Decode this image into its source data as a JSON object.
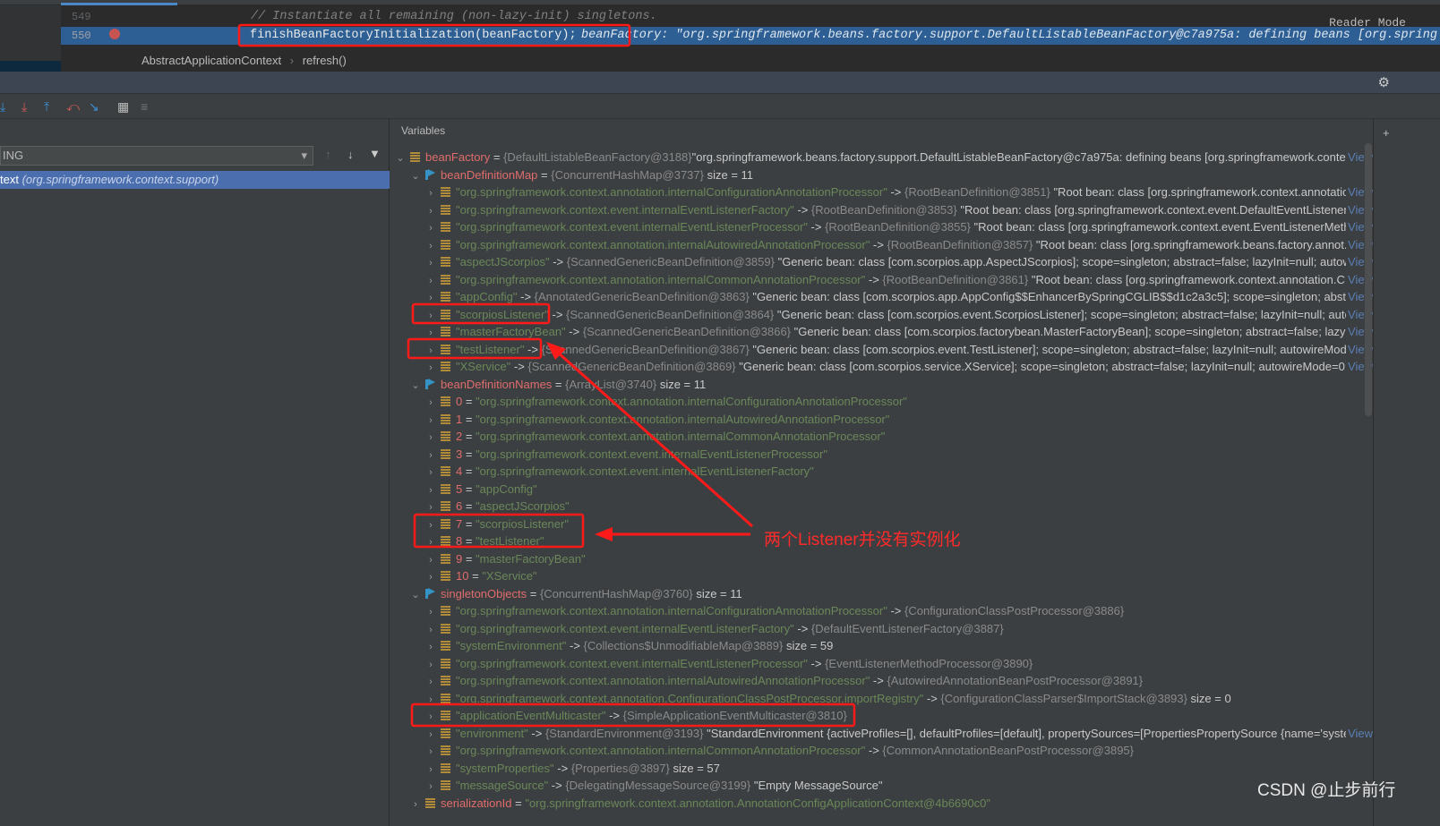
{
  "editor": {
    "lines": [
      {
        "num": "549",
        "code": "// Instantiate all remaining (non-lazy-init) singletons."
      },
      {
        "num": "550",
        "code": "finishBeanFactoryInitialization(beanFactory);",
        "hint": "beanFactory: \"org.springframework.beans.factory.support.DefaultListableBeanFactory@c7a975a: defining beans [org.spring"
      }
    ],
    "reader_mode": "Reader Mode",
    "breadcrumb": [
      "AbstractApplicationContext",
      "refresh()"
    ]
  },
  "frames": {
    "thread": "ING",
    "selected_frame": "text",
    "selected_package": "(org.springframework.context.support)"
  },
  "variables": {
    "header": "Variables",
    "view_label": "View",
    "rows": [
      {
        "l": 0,
        "e": true,
        "i": "field",
        "k": "beanFactory",
        "kc": "nm",
        "op": " = ",
        "t": "{DefaultListableBeanFactory@3188}",
        "x": "\"org.springframework.beans.factory.support.DefaultListableBeanFactory@c7a975a: defining beans [org.springframework.context...",
        "v": true
      },
      {
        "l": 1,
        "e": true,
        "i": "flag",
        "k": "beanDefinitionMap",
        "kc": "nm",
        "op": " = ",
        "t": "{ConcurrentHashMap@3737}",
        "x": " size = 11"
      },
      {
        "l": 2,
        "i": "field",
        "k": "\"org.springframework.context.annotation.internalConfigurationAnnotationProcessor\"",
        "kc": "str",
        "op": " -> ",
        "t": "{RootBeanDefinition@3851}",
        "x": " \"Root bean: class [org.springframework.context.annotatio...",
        "v": true
      },
      {
        "l": 2,
        "i": "field",
        "k": "\"org.springframework.context.event.internalEventListenerFactory\"",
        "kc": "str",
        "op": " -> ",
        "t": "{RootBeanDefinition@3853}",
        "x": " \"Root bean: class [org.springframework.context.event.DefaultEventListenerFa...",
        "v": true
      },
      {
        "l": 2,
        "i": "field",
        "k": "\"org.springframework.context.event.internalEventListenerProcessor\"",
        "kc": "str",
        "op": " -> ",
        "t": "{RootBeanDefinition@3855}",
        "x": " \"Root bean: class [org.springframework.context.event.EventListenerMetho...",
        "v": true
      },
      {
        "l": 2,
        "i": "field",
        "k": "\"org.springframework.context.annotation.internalAutowiredAnnotationProcessor\"",
        "kc": "str",
        "op": " -> ",
        "t": "{RootBeanDefinition@3857}",
        "x": " \"Root bean: class [org.springframework.beans.factory.annot...",
        "v": true
      },
      {
        "l": 2,
        "i": "field",
        "k": "\"aspectJScorpios\"",
        "kc": "str",
        "op": " -> ",
        "t": "{ScannedGenericBeanDefinition@3859}",
        "x": " \"Generic bean: class [com.scorpios.app.AspectJScorpios]; scope=singleton; abstract=false; lazyInit=null; autowir...",
        "v": true
      },
      {
        "l": 2,
        "i": "field",
        "k": "\"org.springframework.context.annotation.internalCommonAnnotationProcessor\"",
        "kc": "str",
        "op": " -> ",
        "t": "{RootBeanDefinition@3861}",
        "x": " \"Root bean: class [org.springframework.context.annotation.C...",
        "v": true
      },
      {
        "l": 2,
        "i": "field",
        "k": "\"appConfig\"",
        "kc": "str",
        "op": " -> ",
        "t": "{AnnotatedGenericBeanDefinition@3863}",
        "x": " \"Generic bean: class [com.scorpios.app.AppConfig$$EnhancerBySpringCGLIB$$d1c2a3c5]; scope=singleton; abstrac...",
        "v": true
      },
      {
        "l": 2,
        "i": "field",
        "k": "\"scorpiosListener\"",
        "kc": "str",
        "op": " -> ",
        "t": "{ScannedGenericBeanDefinition@3864}",
        "x": " \"Generic bean: class [com.scorpios.event.ScorpiosListener]; scope=singleton; abstract=false; lazyInit=null; autow...",
        "v": true
      },
      {
        "l": 2,
        "i": "field",
        "k": "\"masterFactoryBean\"",
        "kc": "str",
        "op": " -> ",
        "t": "{ScannedGenericBeanDefinition@3866}",
        "x": " \"Generic bean: class [com.scorpios.factorybean.MasterFactoryBean]; scope=singleton; abstract=false; lazyInit...",
        "v": true
      },
      {
        "l": 2,
        "i": "field",
        "k": "\"testListener\"",
        "kc": "str",
        "op": " -> ",
        "t": "{ScannedGenericBeanDefinition@3867}",
        "x": " \"Generic bean: class [com.scorpios.event.TestListener]; scope=singleton; abstract=false; lazyInit=null; autowireMode=...",
        "v": true
      },
      {
        "l": 2,
        "i": "field",
        "k": "\"XService\"",
        "kc": "str",
        "op": " -> ",
        "t": "{ScannedGenericBeanDefinition@3869}",
        "x": " \"Generic bean: class [com.scorpios.service.XService]; scope=singleton; abstract=false; lazyInit=null; autowireMode=0; d...",
        "v": true
      },
      {
        "l": 1,
        "e": true,
        "i": "flag",
        "k": "beanDefinitionNames",
        "kc": "nm",
        "op": " = ",
        "t": "{ArrayList@3740}",
        "x": " size = 11"
      },
      {
        "l": 2,
        "i": "field",
        "k": "0",
        "kc": "nm",
        "op": " = ",
        "t": "",
        "s": "\"org.springframework.context.annotation.internalConfigurationAnnotationProcessor\""
      },
      {
        "l": 2,
        "i": "field",
        "k": "1",
        "kc": "nm",
        "op": " = ",
        "t": "",
        "s": "\"org.springframework.context.annotation.internalAutowiredAnnotationProcessor\""
      },
      {
        "l": 2,
        "i": "field",
        "k": "2",
        "kc": "nm",
        "op": " = ",
        "t": "",
        "s": "\"org.springframework.context.annotation.internalCommonAnnotationProcessor\""
      },
      {
        "l": 2,
        "i": "field",
        "k": "3",
        "kc": "nm",
        "op": " = ",
        "t": "",
        "s": "\"org.springframework.context.event.internalEventListenerProcessor\""
      },
      {
        "l": 2,
        "i": "field",
        "k": "4",
        "kc": "nm",
        "op": " = ",
        "t": "",
        "s": "\"org.springframework.context.event.internalEventListenerFactory\""
      },
      {
        "l": 2,
        "i": "field",
        "k": "5",
        "kc": "nm",
        "op": " = ",
        "t": "",
        "s": "\"appConfig\""
      },
      {
        "l": 2,
        "i": "field",
        "k": "6",
        "kc": "nm",
        "op": " = ",
        "t": "",
        "s": "\"aspectJScorpios\""
      },
      {
        "l": 2,
        "i": "field",
        "k": "7",
        "kc": "nm",
        "op": " = ",
        "t": "",
        "s": "\"scorpiosListener\""
      },
      {
        "l": 2,
        "i": "field",
        "k": "8",
        "kc": "nm",
        "op": " = ",
        "t": "",
        "s": "\"testListener\""
      },
      {
        "l": 2,
        "i": "field",
        "k": "9",
        "kc": "nm",
        "op": " = ",
        "t": "",
        "s": "\"masterFactoryBean\""
      },
      {
        "l": 2,
        "i": "field",
        "k": "10",
        "kc": "nm",
        "op": " = ",
        "t": "",
        "s": "\"XService\""
      },
      {
        "l": 1,
        "e": true,
        "i": "flag",
        "k": "singletonObjects",
        "kc": "nm",
        "op": " = ",
        "t": "{ConcurrentHashMap@3760}",
        "x": " size = 11"
      },
      {
        "l": 2,
        "i": "field",
        "k": "\"org.springframework.context.annotation.internalConfigurationAnnotationProcessor\"",
        "kc": "str",
        "op": " -> ",
        "t": "{ConfigurationClassPostProcessor@3886}"
      },
      {
        "l": 2,
        "i": "field",
        "k": "\"org.springframework.context.event.internalEventListenerFactory\"",
        "kc": "str",
        "op": " -> ",
        "t": "{DefaultEventListenerFactory@3887}"
      },
      {
        "l": 2,
        "i": "field",
        "k": "\"systemEnvironment\"",
        "kc": "str",
        "op": " -> ",
        "t": "{Collections$UnmodifiableMap@3889}",
        "x": " size = 59"
      },
      {
        "l": 2,
        "i": "field",
        "k": "\"org.springframework.context.event.internalEventListenerProcessor\"",
        "kc": "str",
        "op": " -> ",
        "t": "{EventListenerMethodProcessor@3890}"
      },
      {
        "l": 2,
        "i": "field",
        "k": "\"org.springframework.context.annotation.internalAutowiredAnnotationProcessor\"",
        "kc": "str",
        "op": " -> ",
        "t": "{AutowiredAnnotationBeanPostProcessor@3891}"
      },
      {
        "l": 2,
        "i": "field",
        "k": "\"org.springframework.context.annotation.ConfigurationClassPostProcessor.importRegistry\"",
        "kc": "str",
        "op": " -> ",
        "t": "{ConfigurationClassParser$ImportStack@3893}",
        "x": " size = 0"
      },
      {
        "l": 2,
        "i": "field",
        "k": "\"applicationEventMulticaster\"",
        "kc": "str",
        "op": " -> ",
        "t": "{SimpleApplicationEventMulticaster@3810}"
      },
      {
        "l": 2,
        "i": "field",
        "k": "\"environment\"",
        "kc": "str",
        "op": " -> ",
        "t": "{StandardEnvironment@3193}",
        "x": " \"StandardEnvironment {activeProfiles=[], defaultProfiles=[default], propertySources=[PropertiesPropertySource {name='syste...",
        "v": true
      },
      {
        "l": 2,
        "i": "field",
        "k": "\"org.springframework.context.annotation.internalCommonAnnotationProcessor\"",
        "kc": "str",
        "op": " -> ",
        "t": "{CommonAnnotationBeanPostProcessor@3895}"
      },
      {
        "l": 2,
        "i": "field",
        "k": "\"systemProperties\"",
        "kc": "str",
        "op": " -> ",
        "t": "{Properties@3897}",
        "x": " size = 57"
      },
      {
        "l": 2,
        "i": "field",
        "k": "\"messageSource\"",
        "kc": "str",
        "op": " -> ",
        "t": "{DelegatingMessageSource@3199}",
        "x": " \"Empty MessageSource\""
      },
      {
        "l": 1,
        "i": "field",
        "k": "serializationId",
        "kc": "nm",
        "op": " = ",
        "t": "",
        "s": "\"org.springframework.context.annotation.AnnotationConfigApplicationContext@4b6690c0\""
      }
    ]
  },
  "annotation": {
    "text": "两个Listener并没有实例化",
    "color": "#ff2a2a"
  },
  "watermark": "CSDN @止步前行",
  "colors": {
    "name": "#e06c6c",
    "string": "#6a8759",
    "type": "#8a8a8a",
    "selection": "#4b6eaf",
    "current_line": "#2d5f94"
  }
}
